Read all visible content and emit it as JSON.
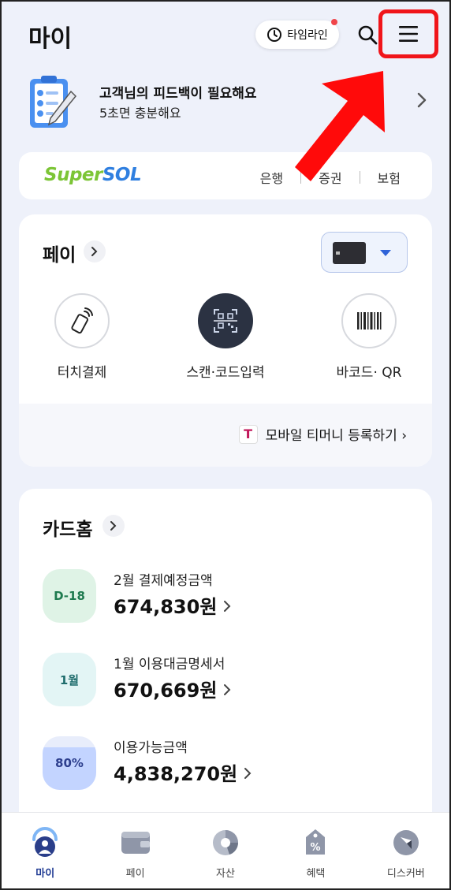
{
  "header": {
    "title": "마이",
    "timeline_label": "타임라인"
  },
  "feedback": {
    "title": "고객님의 피드백이 필요해요",
    "subtitle": "5초면 충분해요"
  },
  "supersol": {
    "logo_super": "Super",
    "logo_sol": "SOL",
    "links": [
      "은행",
      "증권",
      "보험"
    ]
  },
  "pay": {
    "title": "페이",
    "actions": [
      {
        "label": "터치결제",
        "icon": "touch-pay-icon"
      },
      {
        "label": "스캔·코드입력",
        "icon": "qr-scan-icon"
      },
      {
        "label": "바코드· QR",
        "icon": "barcode-icon"
      }
    ],
    "tmoney_logo": "T",
    "tmoney_label": "모바일 티머니 등록하기 ›"
  },
  "cardhome": {
    "title": "카드홈",
    "rows": [
      {
        "badge": "D-18",
        "label": "2월 결제예정금액",
        "amount": "674,830원",
        "badge_color": "#dff3e6",
        "badge_text_color": "#1e7a4f"
      },
      {
        "badge": "1월",
        "label": "1월 이용대금명세서",
        "amount": "670,669원",
        "badge_color": "#e3f5f5",
        "badge_text_color": "#1f6d6d"
      },
      {
        "badge": "80%",
        "label": "이용가능금액",
        "amount": "4,838,270원",
        "badge_color": "#e8edfb",
        "badge_text_color": "#2d3f8e",
        "fill_fraction": 0.8
      }
    ]
  },
  "nav": [
    {
      "label": "마이",
      "icon": "my-icon",
      "active": true
    },
    {
      "label": "페이",
      "icon": "wallet-icon",
      "active": false
    },
    {
      "label": "자산",
      "icon": "asset-chart-icon",
      "active": false
    },
    {
      "label": "혜택",
      "icon": "benefit-tag-icon",
      "active": false
    },
    {
      "label": "디스커버",
      "icon": "discover-compass-icon",
      "active": false
    }
  ],
  "colors": {
    "highlight": "#f0151a",
    "accent": "#2f63d8",
    "background": "#eef1fa"
  }
}
